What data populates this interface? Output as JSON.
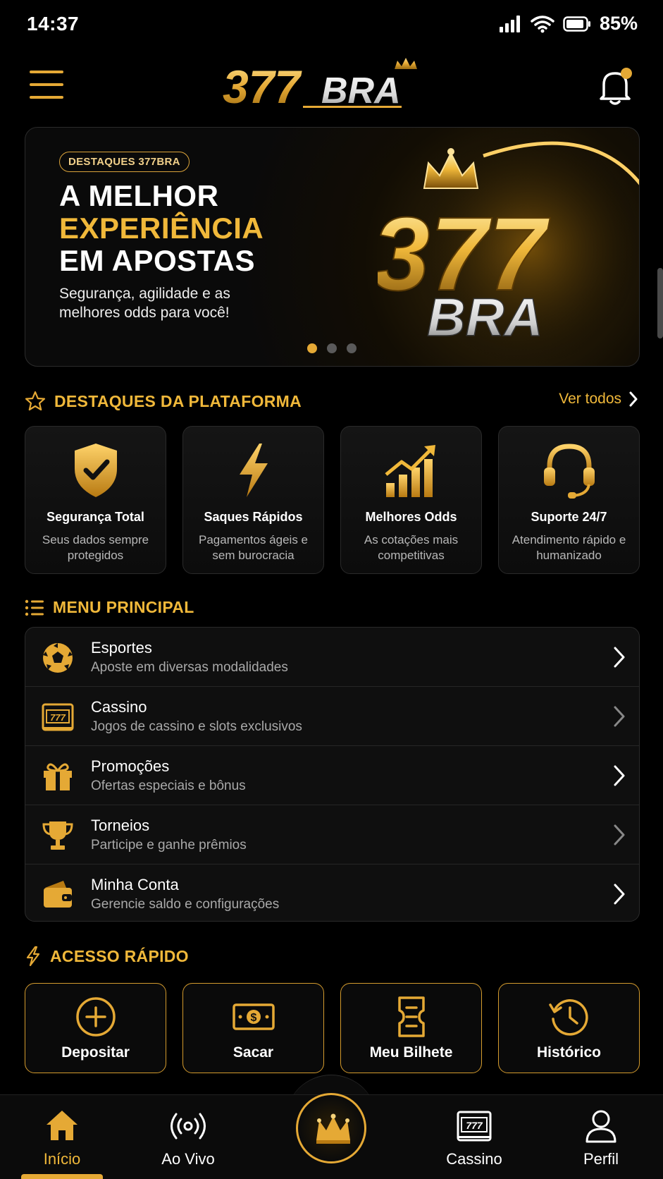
{
  "status": {
    "time": "14:37",
    "battery": "85%"
  },
  "header": {
    "logo_number": "377",
    "logo_text": "BRA"
  },
  "banner": {
    "tag": "DESTAQUES 377BRA",
    "line1": "A MELHOR",
    "line2": "EXPERIÊNCIA",
    "line3": "EM APOSTAS",
    "subtitle_line1": "Segurança, agilidade e as",
    "subtitle_line2": "melhores odds para você!",
    "art_number": "377",
    "art_text": "BRA"
  },
  "highlights": {
    "title": "DESTAQUES DA PLATAFORMA",
    "see_all": "Ver todos",
    "cards": [
      {
        "title": "Segurança Total",
        "desc": "Seus dados sempre protegidos",
        "icon": "shield-check-icon"
      },
      {
        "title": "Saques Rápidos",
        "desc": "Pagamentos ágeis e sem burocracia",
        "icon": "lightning-icon"
      },
      {
        "title": "Melhores Odds",
        "desc": "As cotações mais competitivas",
        "icon": "chart-up-icon"
      },
      {
        "title": "Suporte 24/7",
        "desc": "Atendimento rápido e humanizado",
        "icon": "headset-icon"
      }
    ]
  },
  "main_menu": {
    "title": "MENU PRINCIPAL",
    "items": [
      {
        "title": "Esportes",
        "sub": "Aposte em diversas modalidades",
        "icon": "soccer-ball-icon"
      },
      {
        "title": "Cassino",
        "sub": "Jogos de cassino e slots exclusivos",
        "icon": "slot-machine-icon"
      },
      {
        "title": "Promoções",
        "sub": "Ofertas especiais e bônus",
        "icon": "gift-icon"
      },
      {
        "title": "Torneios",
        "sub": "Participe e ganhe prêmios",
        "icon": "trophy-icon"
      },
      {
        "title": "Minha Conta",
        "sub": "Gerencie saldo e configurações",
        "icon": "wallet-icon"
      }
    ]
  },
  "quick_access": {
    "title": "ACESSO RÁPIDO",
    "items": [
      {
        "label": "Depositar",
        "icon": "plus-circle-icon"
      },
      {
        "label": "Sacar",
        "icon": "cash-icon"
      },
      {
        "label": "Meu Bilhete",
        "icon": "ticket-icon"
      },
      {
        "label": "Histórico",
        "icon": "history-icon"
      }
    ]
  },
  "bottom_nav": {
    "items": [
      {
        "label": "Início",
        "icon": "home-icon",
        "active": true
      },
      {
        "label": "Ao Vivo",
        "icon": "live-icon"
      },
      {
        "label": "Cassino",
        "icon": "slot-machine-icon"
      },
      {
        "label": "Perfil",
        "icon": "user-icon"
      }
    ],
    "center_icon": "crown-icon"
  },
  "colors": {
    "gold": "#f0b83a",
    "gold_dark": "#d49b2d",
    "background": "#000000",
    "card": "#121212"
  }
}
